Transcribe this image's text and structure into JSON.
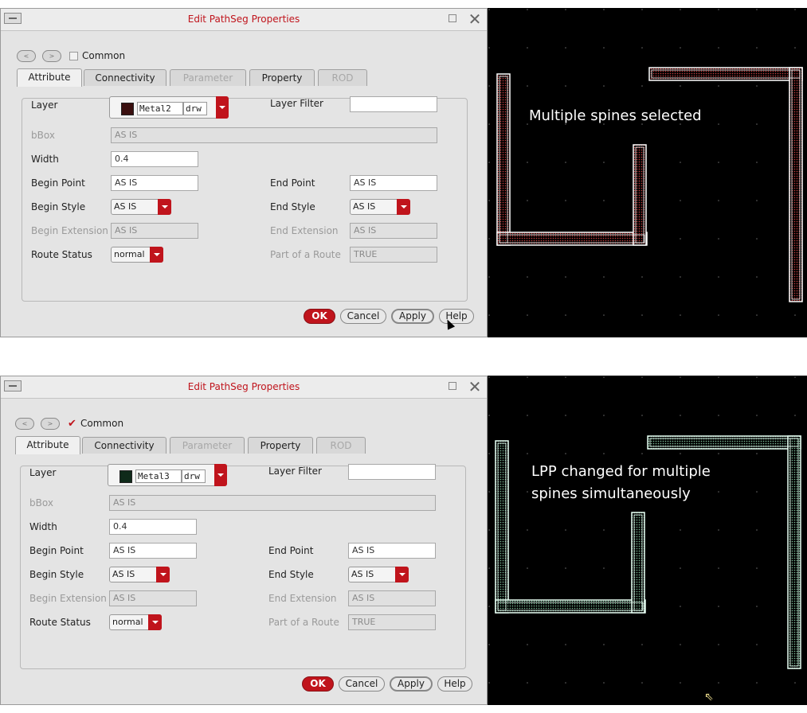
{
  "dialogs": [
    {
      "title": "Edit PathSeg Properties",
      "common_label": "Common",
      "common_checked": false,
      "tabs": [
        {
          "label": "Attribute",
          "state": "active"
        },
        {
          "label": "Connectivity",
          "state": "enabled"
        },
        {
          "label": "Parameter",
          "state": "disabled"
        },
        {
          "label": "Property",
          "state": "enabled"
        },
        {
          "label": "ROD",
          "state": "disabled"
        }
      ],
      "layer_label": "Layer",
      "layer_name": "Metal2",
      "layer_purpose": "drw",
      "layer_swatch_color": "#3a0f0f",
      "layer_filter_label": "Layer Filter",
      "layer_filter_value": "",
      "bbox_label": "bBox",
      "bbox_value": "AS IS",
      "width_label": "Width",
      "width_value": "0.4",
      "begin_point_label": "Begin Point",
      "begin_point_value": "AS IS",
      "end_point_label": "End Point",
      "end_point_value": "AS IS",
      "begin_style_label": "Begin Style",
      "begin_style_value": "AS IS",
      "end_style_label": "End Style",
      "end_style_value": "AS IS",
      "begin_ext_label": "Begin Extension",
      "begin_ext_value": "AS IS",
      "end_ext_label": "End Extension",
      "end_ext_value": "AS IS",
      "route_status_label": "Route Status",
      "route_status_value": "normal",
      "part_of_route_label": "Part of a Route",
      "part_of_route_value": "TRUE",
      "buttons": {
        "ok": "OK",
        "cancel": "Cancel",
        "apply": "Apply",
        "help": "Help"
      }
    },
    {
      "title": "Edit PathSeg Properties",
      "common_label": "Common",
      "common_checked": true,
      "tabs": [
        {
          "label": "Attribute",
          "state": "active"
        },
        {
          "label": "Connectivity",
          "state": "enabled"
        },
        {
          "label": "Parameter",
          "state": "disabled"
        },
        {
          "label": "Property",
          "state": "enabled"
        },
        {
          "label": "ROD",
          "state": "disabled"
        }
      ],
      "layer_label": "Layer",
      "layer_name": "Metal3",
      "layer_purpose": "drw",
      "layer_swatch_color": "#0f2a1a",
      "layer_filter_label": "Layer Filter",
      "layer_filter_value": "",
      "bbox_label": "bBox",
      "bbox_value": "AS IS",
      "width_label": "Width",
      "width_value": "0.4",
      "begin_point_label": "Begin Point",
      "begin_point_value": "AS IS",
      "end_point_label": "End Point",
      "end_point_value": "AS IS",
      "begin_style_label": "Begin Style",
      "begin_style_value": "AS IS",
      "end_style_label": "End Style",
      "end_style_value": "AS IS",
      "begin_ext_label": "Begin Extension",
      "begin_ext_value": "AS IS",
      "end_ext_label": "End Extension",
      "end_ext_value": "AS IS",
      "route_status_label": "Route Status",
      "route_status_value": "normal",
      "part_of_route_label": "Part of a Route",
      "part_of_route_value": "TRUE",
      "buttons": {
        "ok": "OK",
        "cancel": "Cancel",
        "apply": "Apply",
        "help": "Help"
      }
    }
  ],
  "layouts": [
    {
      "caption_lines": [
        "Multiple spines selected"
      ],
      "wire_fill": "#3a1414",
      "wire_outline": "#ffffff"
    },
    {
      "caption_lines": [
        "LPP changed for multiple",
        "spines simultaneously"
      ],
      "wire_fill": "#1c3a2a",
      "wire_outline": "#e8fff4"
    }
  ],
  "colors": {
    "accent_red": "#c0141c",
    "canvas_bg": "#000000"
  },
  "icons": {
    "window_menu": "window-menu-icon",
    "minimize": "minimize-icon",
    "close": "close-icon",
    "prev": "prev-arrow-icon",
    "next": "next-arrow-icon"
  }
}
